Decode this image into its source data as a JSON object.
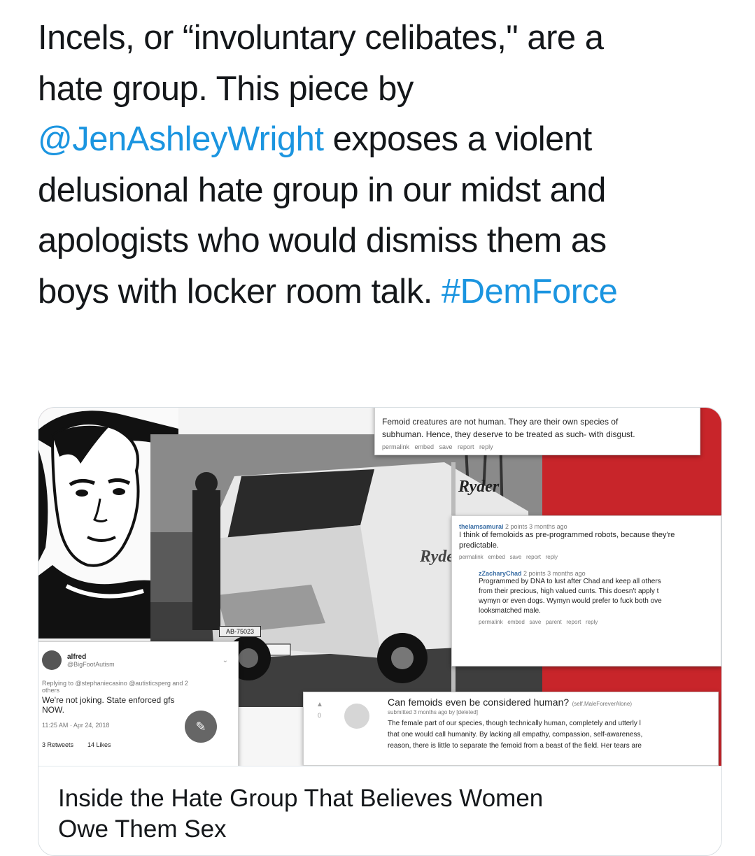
{
  "tweet": {
    "text_l1": "Incels, or “involuntary celibates,\" are a",
    "text_l2": "hate group.  This piece by",
    "mention": "@JenAshleyWright",
    "text_l3_rest": " exposes a violent",
    "text_l4": "delusional hate group in our midst and",
    "text_l5": "apologists who would dismiss them as",
    "text_l6": "boys with locker room talk. ",
    "hashtag": "#DemForce"
  },
  "card": {
    "title_line1": "Inside the Hate Group That Believes Women",
    "title_line2": "Owe Them Sex",
    "collage": {
      "comment1": {
        "line1": "Femoid creatures are not human. They are their own species of",
        "line2": "subhuman. Hence, they deserve to be treated as such- with disgust.",
        "actions": "permalink   embed   save   report   reply"
      },
      "comment2": {
        "user": "thelamsamurai",
        "meta": "2 points 3 months ago",
        "line1": "I think of femoloids as pre-programmed robots, because they're",
        "line2": "predictable.",
        "actions": "permalink   embed   save   report   reply"
      },
      "comment3": {
        "user": "zZacharyChad",
        "meta": "2 points 3 months ago",
        "line1": "Programmed by DNA to lust after Chad and keep all others",
        "line2": "from their precious, high valued cunts. This doesn't apply t",
        "line3": "wymyn or even dogs. Wymyn would prefer to fuck both ove",
        "line4": "looksmatched male.",
        "actions": "permalink   embed   save   parent   report   reply"
      },
      "post": {
        "title": "Can femoids even be considered human?",
        "flair": "(self.MaleForeverAlone)",
        "submitted": "submitted 3 months ago by [deleted]",
        "vote": "0",
        "line1": "The female part of our species, though technically human, completely and utterly l",
        "line2": "that one would call humanity. By lacking all empathy, compassion, self-awareness,",
        "line3": "reason, there is little to separate the femoid from a beast of the field. Her tears are"
      },
      "embedded_tweet": {
        "name": "alfred",
        "handle": "@BigFootAutism",
        "replying": "Replying to @stephaniecasino @autisticsperg and 2",
        "replying2": "others",
        "text1": "We're not joking. State enforced gfs",
        "text2": "NOW.",
        "time": "11:25 AM · Apr 24, 2018",
        "retweets": "3 Retweets",
        "likes": "14 Likes"
      },
      "van_brand": "Ryder",
      "van_side": "Ryde",
      "plate": "AB-75023"
    }
  },
  "colors": {
    "text": "#14171a",
    "link": "#1b95e0",
    "accent_red": "#c8252a"
  }
}
